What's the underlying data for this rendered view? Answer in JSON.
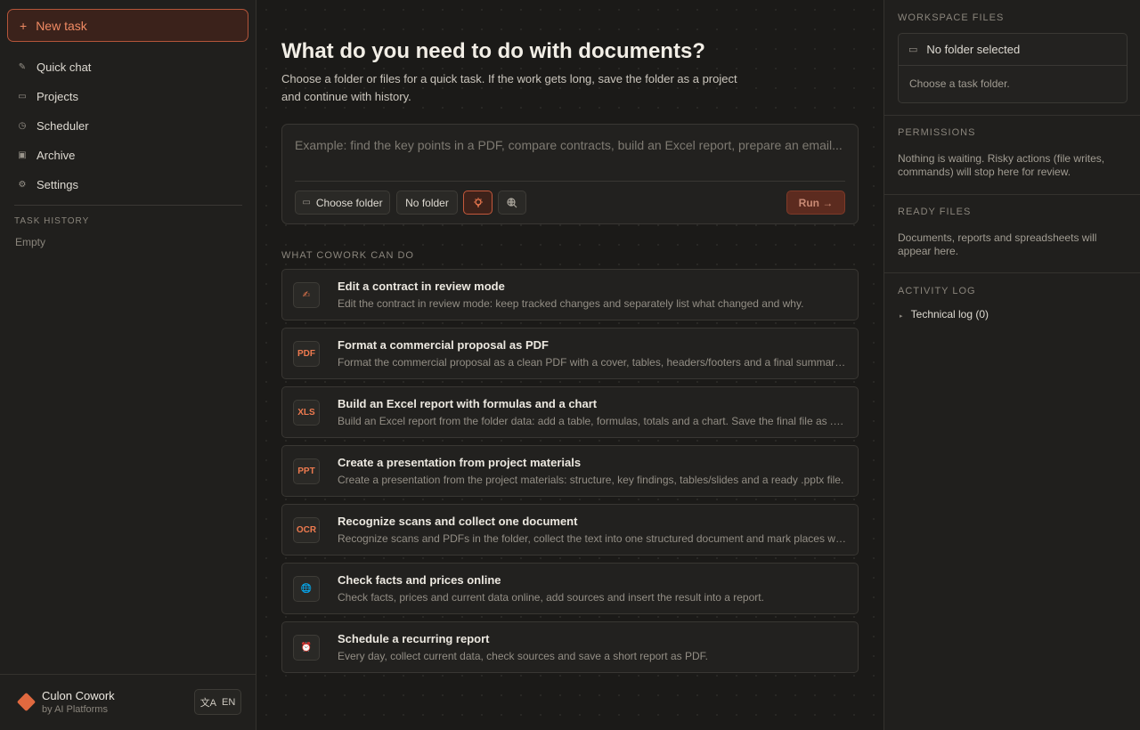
{
  "sidebar": {
    "new_task_label": "New task",
    "new_task_icon": "+",
    "items": [
      {
        "label": "Quick chat",
        "icon": "pencil-icon",
        "glyph": "✎"
      },
      {
        "label": "Projects",
        "icon": "folder-icon",
        "glyph": "▭"
      },
      {
        "label": "Scheduler",
        "icon": "clock-icon",
        "glyph": "◷"
      },
      {
        "label": "Archive",
        "icon": "archive-icon",
        "glyph": "▣"
      },
      {
        "label": "Settings",
        "icon": "gear-icon",
        "glyph": "⚙"
      }
    ],
    "history_heading": "TASK HISTORY",
    "history_empty": "Empty",
    "brand_name": "Culon Cowork",
    "brand_sub": "by AI Platforms",
    "lang_glyph": "文A",
    "lang_label": "EN"
  },
  "main": {
    "title": "What do you need to do with documents?",
    "subtitle": "Choose a folder or files for a quick task. If the work gets long, save the folder as a project and continue with history.",
    "composer": {
      "placeholder": "Example: find the key points in a PDF, compare contracts, build an Excel report, prepare an email...",
      "choose_folder_label": "Choose folder",
      "no_folder_label": "No folder",
      "run_label": "Run →"
    },
    "capabilities_heading": "WHAT COWORK CAN DO",
    "cards": [
      {
        "badge": "✍",
        "icon": "writing-hand-icon",
        "title": "Edit a contract in review mode",
        "desc": "Edit the contract in review mode: keep tracked changes and separately list what changed and why."
      },
      {
        "badge": "PDF",
        "icon": "pdf-icon",
        "title": "Format a commercial proposal as PDF",
        "desc": "Format the commercial proposal as a clean PDF with a cover, tables, headers/footers and a final summary block."
      },
      {
        "badge": "XLS",
        "icon": "xls-icon",
        "title": "Build an Excel report with formulas and a chart",
        "desc": "Build an Excel report from the folder data: add a table, formulas, totals and a chart. Save the final file as .xlsx."
      },
      {
        "badge": "PPT",
        "icon": "ppt-icon",
        "title": "Create a presentation from project materials",
        "desc": "Create a presentation from the project materials: structure, key findings, tables/slides and a ready .pptx file."
      },
      {
        "badge": "OCR",
        "icon": "ocr-icon",
        "title": "Recognize scans and collect one document",
        "desc": "Recognize scans and PDFs in the folder, collect the text into one structured document and mark places with weak recognition."
      },
      {
        "badge": "🌐",
        "icon": "globe-icon",
        "title": "Check facts and prices online",
        "desc": "Check facts, prices and current data online, add sources and insert the result into a report."
      },
      {
        "badge": "⏰",
        "icon": "alarm-clock-icon",
        "title": "Schedule a recurring report",
        "desc": "Every day, collect current data, check sources and save a short report as PDF."
      }
    ]
  },
  "right": {
    "workspace_heading": "WORKSPACE FILES",
    "folder_label": "No folder selected",
    "folder_hint": "Choose a task folder.",
    "permissions_heading": "PERMISSIONS",
    "permissions_text": "Nothing is waiting. Risky actions (file writes, commands) will stop here for review.",
    "ready_heading": "READY FILES",
    "ready_text": "Documents, reports and spreadsheets will appear here.",
    "activity_heading": "ACTIVITY LOG",
    "tech_log_label": "Technical log (0)"
  },
  "colors": {
    "accent": "#e0693f",
    "background": "#1b1a18",
    "panel": "#201f1d"
  }
}
